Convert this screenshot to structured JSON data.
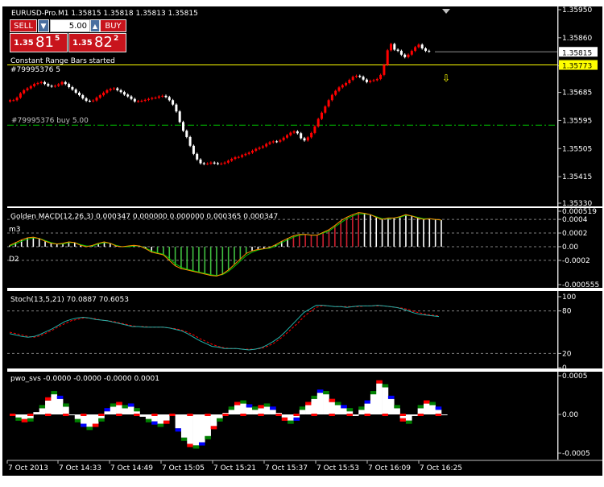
{
  "colors": {
    "background": "#000000",
    "grid": "#c0c0c0",
    "up_candle": "#ff0000",
    "down_candle": "#ffffff",
    "bid_line": "#ffffff",
    "ask_line": "#ffff00",
    "order_line": "#00c000",
    "macd_main": "#ffd700",
    "macd_signal": "#00cc00",
    "stoch_main": "#20b2aa",
    "stoch_signal": "#ff0000",
    "pwo_white": "#ffffff",
    "pwo_red": "#ff0000",
    "pwo_blue": "#0000ff",
    "pwo_green": "#008000"
  },
  "trade_panel": {
    "sell_label": "SELL",
    "buy_label": "BUY",
    "lots": "5.00",
    "sell_prefix": "1.35",
    "sell_big": "81",
    "sell_sup": "5",
    "buy_prefix": "1.35",
    "buy_big": "82",
    "buy_sup": "2"
  },
  "chart_data": [
    {
      "type": "candlestick",
      "title": "EURUSD-Pro.M1 1.35815 1.35818 1.35813 1.35815",
      "annotations": [
        "Constant Range Bars started",
        "#79995376 buy 5.00",
        "#79995376 5"
      ],
      "yticks": [
        "1.35950",
        "1.35860",
        "1.35770",
        "1.35685",
        "1.35595",
        "1.35505",
        "1.35415",
        "1.35330"
      ],
      "ylim": [
        1.3533,
        1.3595
      ],
      "bid_label": "1.35815",
      "ask_label": "1.35773",
      "bid": 1.35815,
      "ask": 1.35773,
      "order_price": 1.3558,
      "close": [
        1.3566,
        1.3566,
        1.35668,
        1.35682,
        1.35692,
        1.35698,
        1.35705,
        1.35712,
        1.35715,
        1.35718,
        1.35712,
        1.35706,
        1.35704,
        1.35706,
        1.35711,
        1.35718,
        1.35712,
        1.35702,
        1.35694,
        1.35684,
        1.35676,
        1.35666,
        1.35658,
        1.35657,
        1.35659,
        1.35668,
        1.35676,
        1.35684,
        1.35692,
        1.35696,
        1.35698,
        1.35692,
        1.35686,
        1.35678,
        1.35672,
        1.35664,
        1.35656,
        1.35657,
        1.35658,
        1.35661,
        1.35664,
        1.35667,
        1.35668,
        1.35672,
        1.35674,
        1.3567,
        1.3566,
        1.35646,
        1.35624,
        1.3559,
        1.35562,
        1.35542,
        1.35514,
        1.35488,
        1.3547,
        1.35458,
        1.35456,
        1.35457,
        1.3546,
        1.35458,
        1.35456,
        1.35457,
        1.3546,
        1.35466,
        1.35472,
        1.35477,
        1.35478,
        1.35484,
        1.35488,
        1.35492,
        1.35498,
        1.35504,
        1.35508,
        1.35512,
        1.3552,
        1.35525,
        1.35528,
        1.35527,
        1.35532,
        1.3554,
        1.35548,
        1.35556,
        1.3556,
        1.35554,
        1.35538,
        1.35531,
        1.35541,
        1.35555,
        1.35576,
        1.356,
        1.3562,
        1.3564,
        1.3566,
        1.35677,
        1.3569,
        1.35701,
        1.35708,
        1.35715,
        1.35725,
        1.35735,
        1.35738,
        1.35735,
        1.35726,
        1.35718,
        1.35722,
        1.35724,
        1.35728,
        1.35741,
        1.35773,
        1.3582,
        1.3584,
        1.35822,
        1.35818,
        1.35806,
        1.35798,
        1.35806,
        1.35818,
        1.3583,
        1.35838,
        1.35826,
        1.35818,
        1.35816
      ],
      "xticks": [
        "7 Oct 2013",
        "7 Oct 14:33",
        "7 Oct 14:49",
        "7 Oct 15:05",
        "7 Oct 15:21",
        "7 Oct 15:37",
        "7 Oct 15:53",
        "7 Oct 16:09",
        "7 Oct 16:25"
      ]
    },
    {
      "type": "histogram+line",
      "title": "Golden MACD(12,26,3) 0.000347 0.000000 0.000000 0.000365 0.000347",
      "side_labels": [
        "m3",
        "D2"
      ],
      "yticks": [
        "0.000519",
        "0.0004",
        "0.0002",
        "0.00",
        "-0.0002",
        "-0.000555"
      ],
      "ylim": [
        -0.000555,
        0.000519
      ],
      "values": [
        2e-05,
        6e-05,
        0.0001,
        0.00013,
        0.00014,
        0.00012,
        8e-05,
        5e-05,
        4e-05,
        5e-05,
        7e-05,
        6e-05,
        2e-05,
        0.0,
        2e-05,
        5e-05,
        7e-05,
        5e-05,
        1e-05,
        0.0,
        1e-05,
        2e-05,
        1e-05,
        -3e-05,
        -8e-05,
        -0.0001,
        -0.00012,
        -0.0002,
        -0.00028,
        -0.00032,
        -0.00034,
        -0.00036,
        -0.00038,
        -0.0004,
        -0.00042,
        -0.00043,
        -0.0004,
        -0.00034,
        -0.00026,
        -0.00018,
        -0.0001,
        -6e-05,
        -4e-05,
        -3e-05,
        -1e-05,
        3e-05,
        8e-05,
        0.00012,
        0.00016,
        0.00018,
        0.00018,
        0.00017,
        0.00017,
        0.00021,
        0.00025,
        0.00031,
        0.00038,
        0.00043,
        0.00047,
        0.0005,
        0.00049,
        0.00047,
        0.00043,
        0.0004,
        0.00042,
        0.00042,
        0.00044,
        0.00047,
        0.00045,
        0.00042,
        0.0004,
        0.00041,
        0.0004,
        0.00039
      ],
      "signal": [
        1e-05,
        4e-05,
        8e-05,
        0.00011,
        0.00013,
        0.00012,
        9e-05,
        6e-05,
        4e-05,
        4e-05,
        6e-05,
        6e-05,
        3e-05,
        1e-05,
        1e-05,
        4e-05,
        6e-05,
        5e-05,
        2e-05,
        0.0,
        0.0,
        1e-05,
        1e-05,
        -2e-05,
        -6e-05,
        -9e-05,
        -0.00011,
        -0.00017,
        -0.00025,
        -0.0003,
        -0.00033,
        -0.00035,
        -0.00037,
        -0.00039,
        -0.00041,
        -0.00042,
        -0.00041,
        -0.00036,
        -0.00029,
        -0.00021,
        -0.00013,
        -8e-05,
        -5e-05,
        -3e-05,
        -2e-05,
        1e-05,
        6e-05,
        0.0001,
        0.00014,
        0.00017,
        0.00018,
        0.00017,
        0.00017,
        0.0002,
        0.00023,
        0.00029,
        0.00035,
        0.00041,
        0.00045,
        0.00048,
        0.00048,
        0.00047,
        0.00044,
        0.00041,
        0.00041,
        0.00042,
        0.00043,
        0.00046,
        0.00045,
        0.00043,
        0.00041,
        0.00041,
        0.0004,
        0.00039
      ]
    },
    {
      "type": "line",
      "title": "Stoch(13,5,21) 70.0887 70.6053",
      "yticks": [
        "100",
        "80",
        "20",
        "0"
      ],
      "ylim": [
        0,
        100
      ],
      "main": [
        48,
        46,
        44,
        43,
        44,
        47,
        51,
        55,
        60,
        65,
        68,
        70,
        71,
        70,
        68,
        67,
        66,
        64,
        62,
        60,
        58,
        58,
        57,
        57,
        57,
        57,
        56,
        54,
        52,
        48,
        43,
        38,
        34,
        30,
        29,
        27,
        27,
        27,
        26,
        25,
        26,
        28,
        32,
        37,
        43,
        51,
        60,
        69,
        78,
        83,
        88,
        88,
        87,
        86,
        86,
        85,
        86,
        87,
        87,
        87,
        88,
        87,
        86,
        85,
        83,
        80,
        77,
        75,
        74,
        73,
        72
      ],
      "signal": [
        50,
        48,
        46,
        44,
        43,
        45,
        49,
        53,
        58,
        62,
        66,
        68,
        70,
        70,
        69,
        67,
        66,
        65,
        63,
        61,
        59,
        58,
        58,
        57,
        57,
        57,
        56,
        55,
        53,
        50,
        46,
        41,
        37,
        33,
        30,
        28,
        27,
        27,
        26,
        26,
        26,
        27,
        30,
        34,
        40,
        47,
        55,
        63,
        72,
        79,
        85,
        87,
        87,
        86,
        86,
        86,
        86,
        86,
        87,
        87,
        87,
        87,
        86,
        85,
        84,
        82,
        79,
        77,
        75,
        74,
        73
      ]
    },
    {
      "type": "histogram",
      "title": "pwo_svs -0.0000 -0.0000 -0.0000 0.0001",
      "yticks": [
        "0.0005",
        "0.00",
        "-0.0005"
      ],
      "ylim": [
        -0.0005,
        0.0005
      ],
      "values": [
        0.0,
        -4e-05,
        -6e-05,
        -5e-05,
        3e-05,
        8e-05,
        0.00018,
        0.00026,
        0.0002,
        0.0001,
        0.0,
        -6e-05,
        -0.00012,
        -0.00016,
        -0.00012,
        -5e-05,
        4e-05,
        0.0001,
        0.00012,
        8e-05,
        0.0001,
        4e-05,
        -3e-05,
        -6e-05,
        -9e-05,
        -0.00012,
        -8e-05,
        -2e-05,
        -0.00018,
        -0.0003,
        -0.00038,
        -0.0004,
        -0.00036,
        -0.00028,
        -0.00015,
        -5e-05,
        2e-05,
        6e-05,
        0.00012,
        0.00014,
        9e-05,
        6e-05,
        8e-05,
        0.0001,
        6e-05,
        2e-05,
        -4e-05,
        -8e-05,
        -4e-05,
        6e-05,
        0.00012,
        0.0002,
        0.00028,
        0.00026,
        0.00016,
        0.00012,
        8e-05,
        4e-05,
        -2e-05,
        6e-05,
        0.00014,
        0.00026,
        0.0004,
        0.00035,
        0.0002,
        8e-05,
        -5e-05,
        -8e-05,
        -2e-05,
        8e-05,
        0.00014,
        0.00012,
        6e-05,
        0.0
      ]
    }
  ]
}
